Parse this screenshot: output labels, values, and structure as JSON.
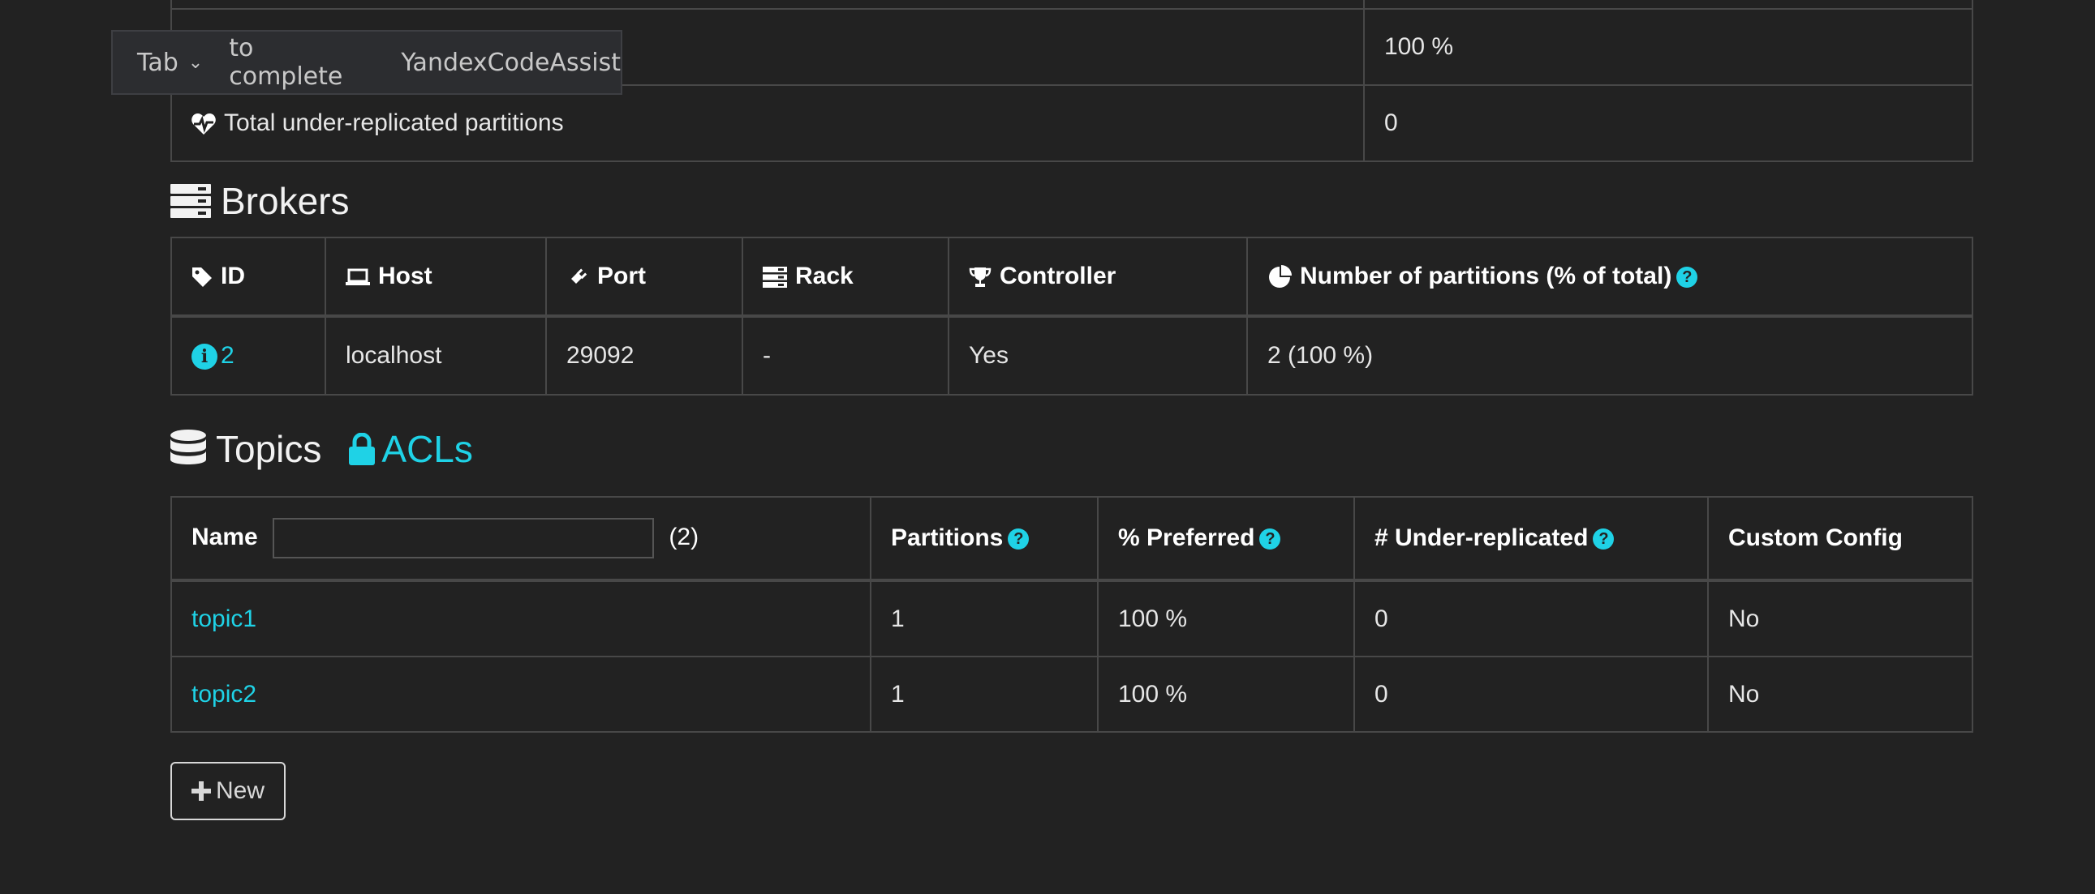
{
  "autocomplete_tooltip": {
    "key": "Tab",
    "action": "to complete",
    "provider": "YandexCodeAssist"
  },
  "summary": {
    "rows": [
      {
        "label": "",
        "value": "100 %"
      },
      {
        "label": "Total under-replicated partitions",
        "value": "0"
      }
    ]
  },
  "brokers": {
    "title": "Brokers",
    "headers": {
      "id": "ID",
      "host": "Host",
      "port": "Port",
      "rack": "Rack",
      "controller": "Controller",
      "partitions": "Number of partitions (% of total)"
    },
    "rows": [
      {
        "id": "2",
        "host": "localhost",
        "port": "29092",
        "rack": "-",
        "controller": "Yes",
        "partitions": "2 (100 %)"
      }
    ]
  },
  "topics": {
    "title": "Topics",
    "acls_link": "ACLs",
    "headers": {
      "name": "Name",
      "count": "(2)",
      "partitions": "Partitions",
      "preferred": "% Preferred",
      "under_replicated": "# Under-replicated",
      "custom_config": "Custom Config"
    },
    "filter": {
      "value": "",
      "placeholder": ""
    },
    "rows": [
      {
        "name": "topic1",
        "partitions": "1",
        "preferred": "100 %",
        "under_replicated": "0",
        "custom_config": "No"
      },
      {
        "name": "topic2",
        "partitions": "1",
        "preferred": "100 %",
        "under_replicated": "0",
        "custom_config": "No"
      }
    ]
  },
  "new_button": {
    "label": "New"
  },
  "colors": {
    "accent": "#1fd2e6",
    "background": "#222222",
    "border": "#484848"
  }
}
